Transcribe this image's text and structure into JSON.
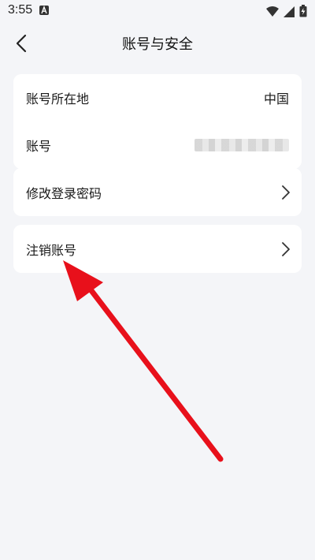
{
  "status_bar": {
    "time": "3:55"
  },
  "header": {
    "title": "账号与安全"
  },
  "account_card": {
    "region_label": "账号所在地",
    "region_value": "中国",
    "account_label": "账号"
  },
  "password_row": {
    "label": "修改登录密码"
  },
  "cancel_row": {
    "label": "注销账号"
  },
  "colors": {
    "annotation_arrow": "#e8101b",
    "background": "#f4f5f8"
  }
}
